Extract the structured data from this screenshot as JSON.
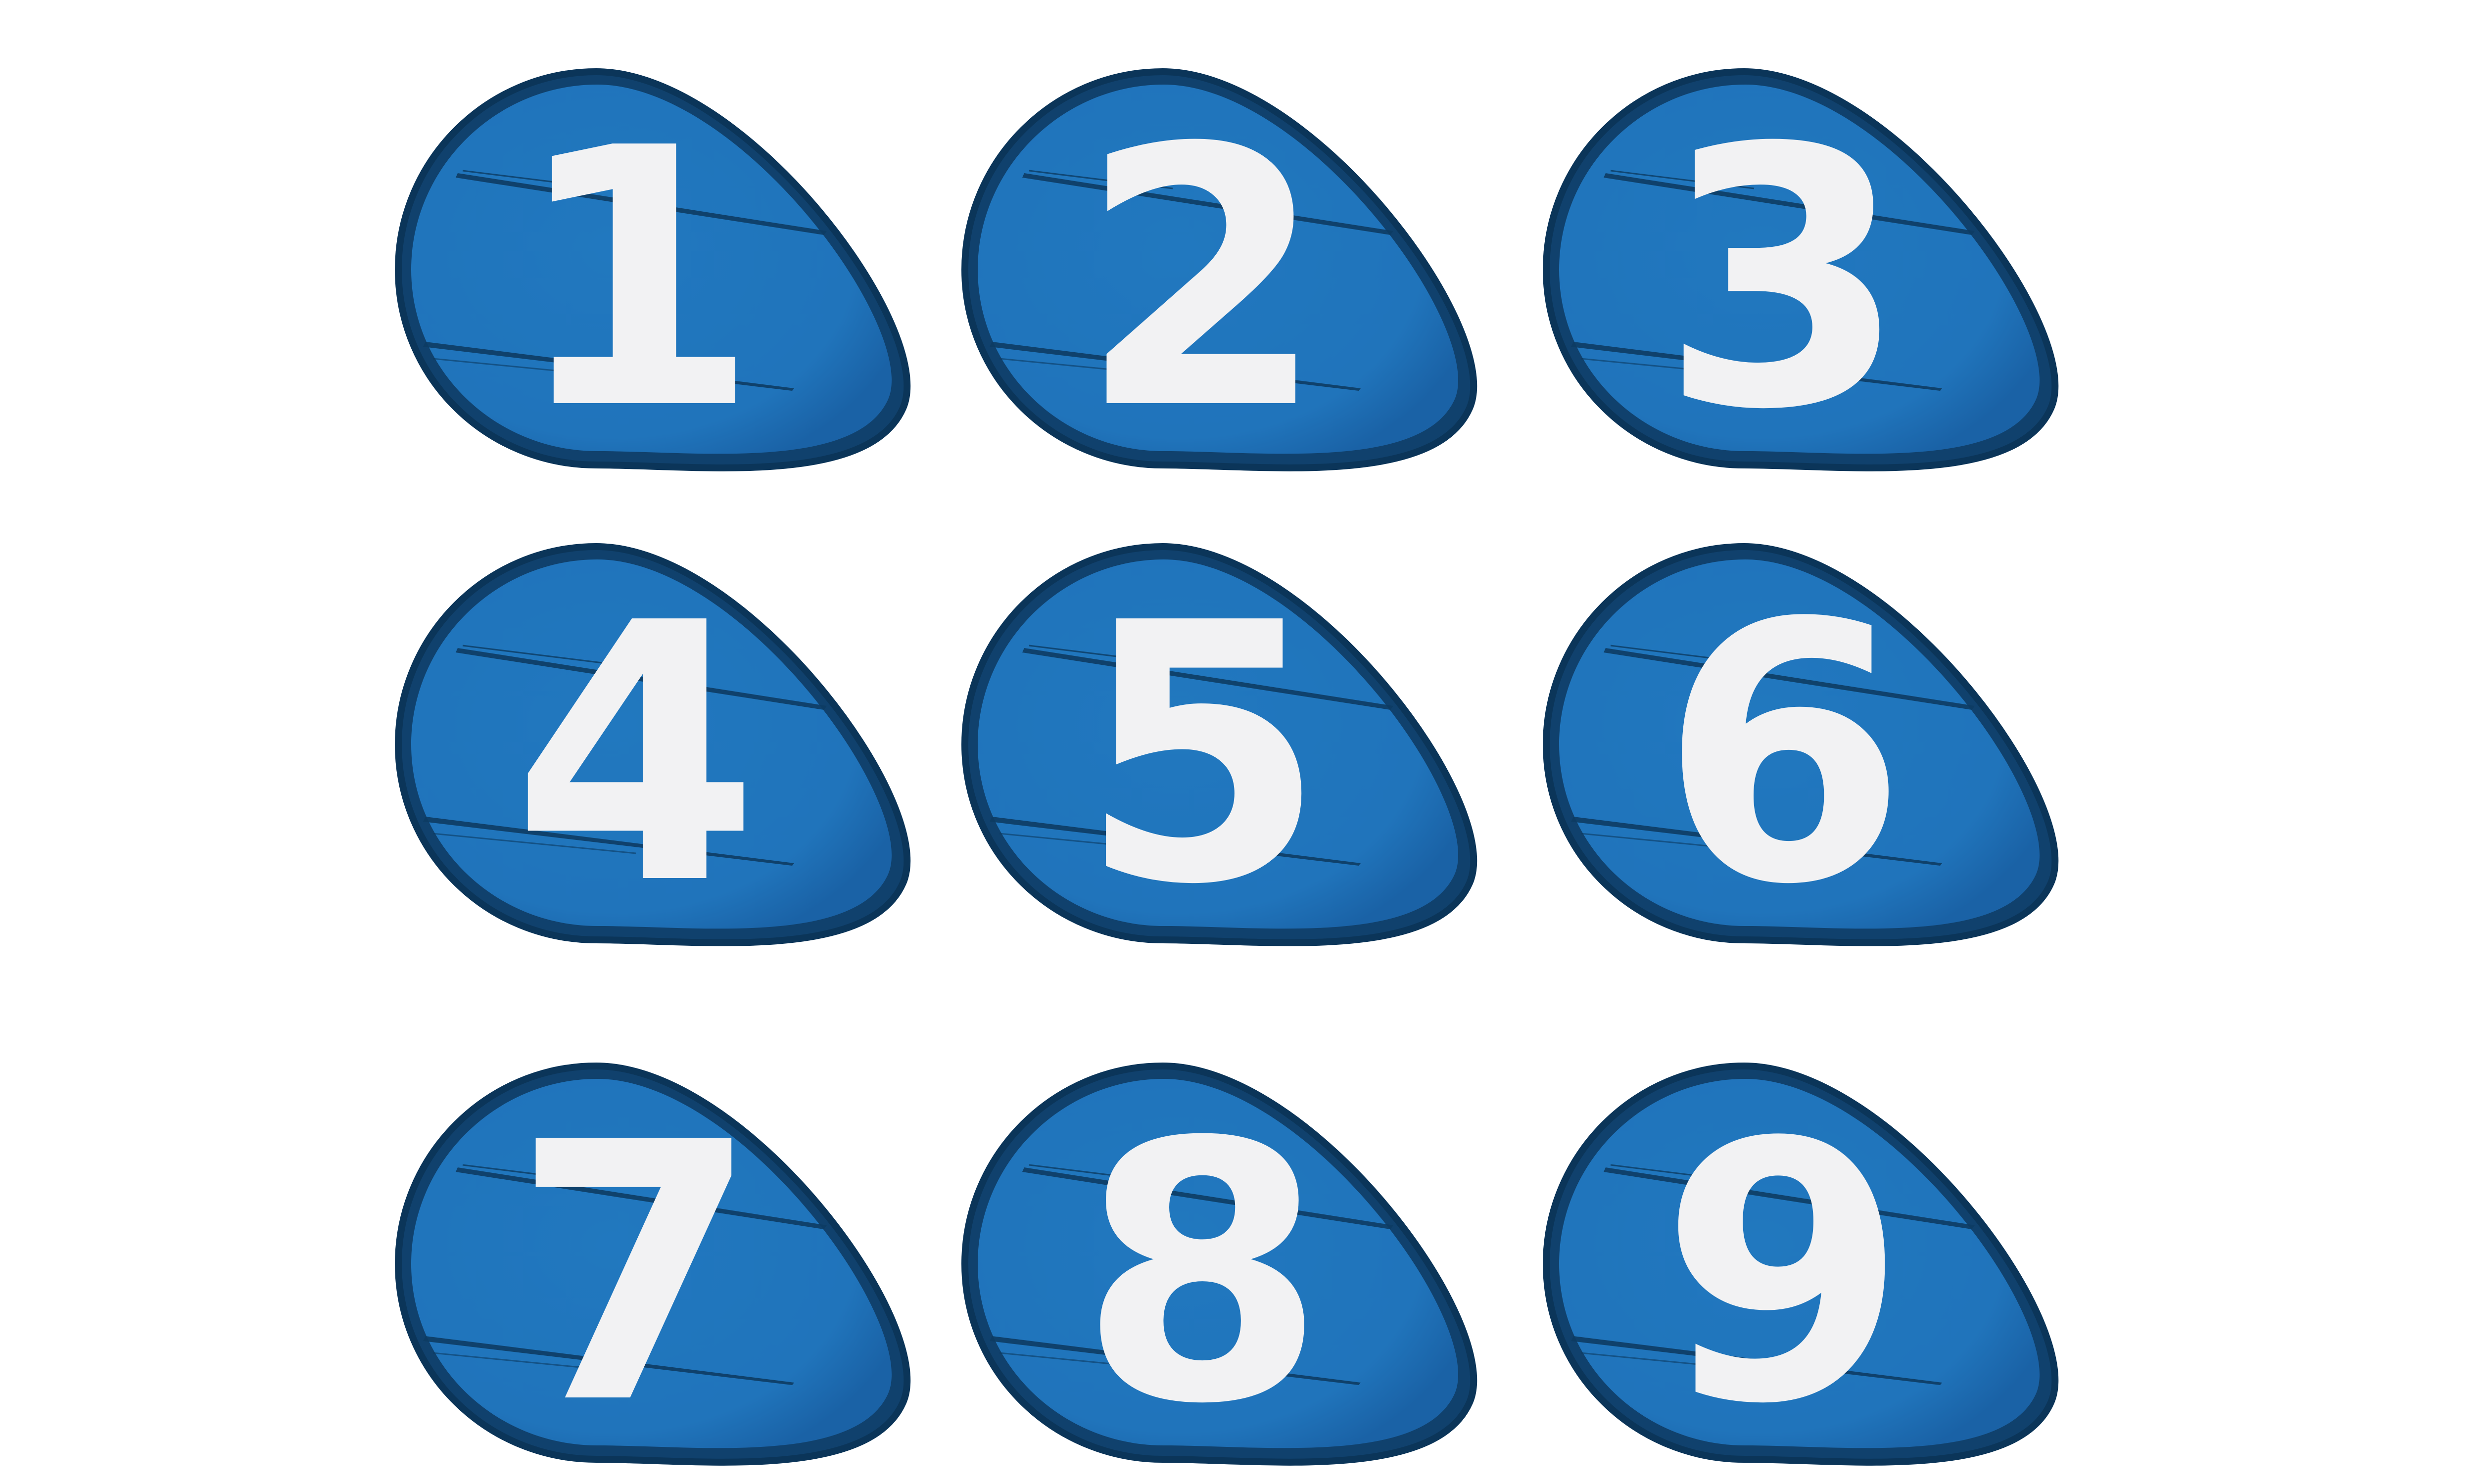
{
  "colors": {
    "background": "#ffffff",
    "badge_fill": "#2178bf",
    "badge_fill_dark": "#1a62a6",
    "badge_rim": "#10416d",
    "badge_outline": "#0b3559",
    "scratch": "#0d3c63",
    "digit": "#f2f2f3"
  },
  "icon": "blue-pebble-number-badge",
  "badges": [
    {
      "digit": "1"
    },
    {
      "digit": "2"
    },
    {
      "digit": "3"
    },
    {
      "digit": "4"
    },
    {
      "digit": "5"
    },
    {
      "digit": "6"
    },
    {
      "digit": "7"
    },
    {
      "digit": "8"
    },
    {
      "digit": "9"
    }
  ]
}
